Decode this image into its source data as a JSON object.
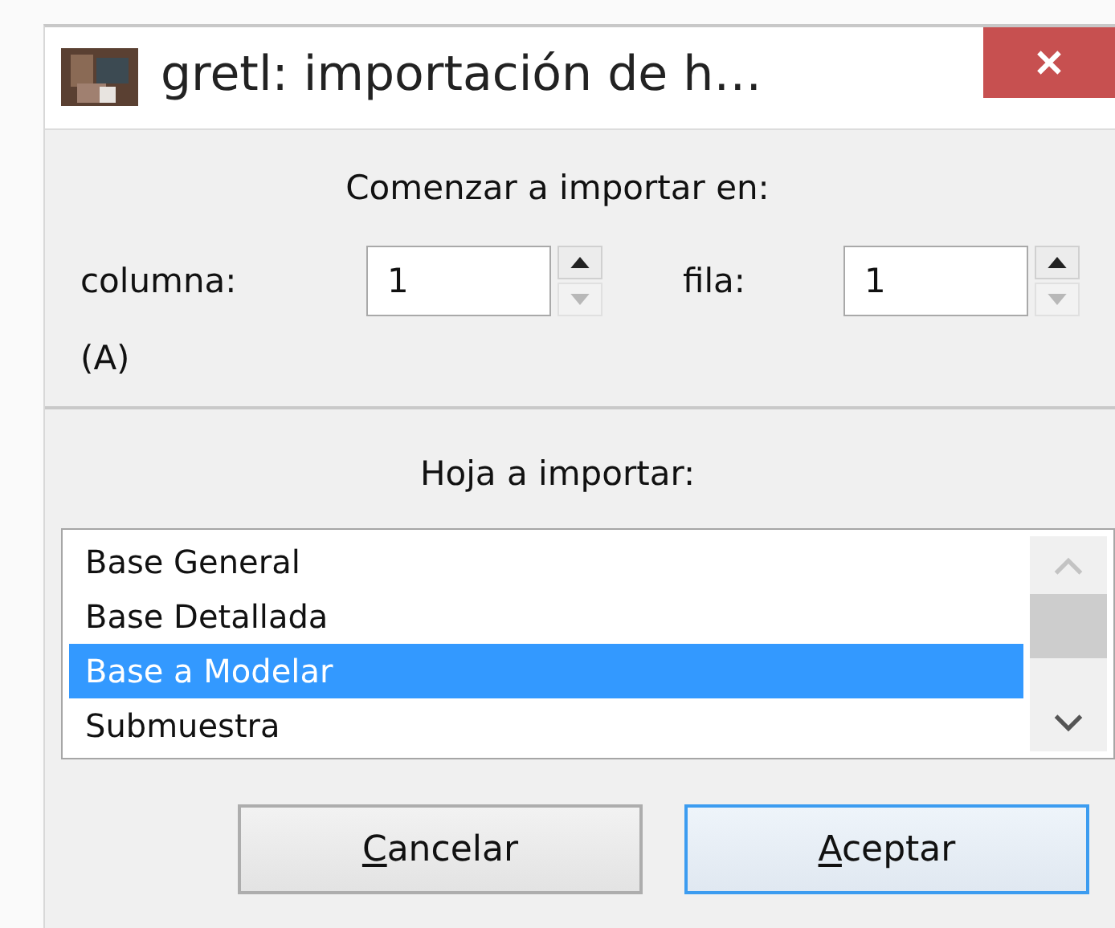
{
  "window": {
    "title": "gretl: importación de h…"
  },
  "start_section": {
    "heading": "Comenzar a importar en:",
    "spinners": [
      {
        "label": "columna:",
        "value": "1",
        "decrement_disabled": true
      },
      {
        "label": "fila:",
        "value": "1",
        "decrement_disabled": true
      }
    ],
    "column_letter": "(A)"
  },
  "sheet_section": {
    "heading": "Hoja a importar:",
    "sheets": [
      {
        "label": "Base General",
        "selected": false
      },
      {
        "label": "Base Detallada",
        "selected": false
      },
      {
        "label": "Base a Modelar",
        "selected": true
      },
      {
        "label": "Submuestra",
        "selected": false
      }
    ]
  },
  "buttons": [
    {
      "label": "Cancelar",
      "focused": false
    },
    {
      "label": "Aceptar",
      "focused": true
    }
  ]
}
